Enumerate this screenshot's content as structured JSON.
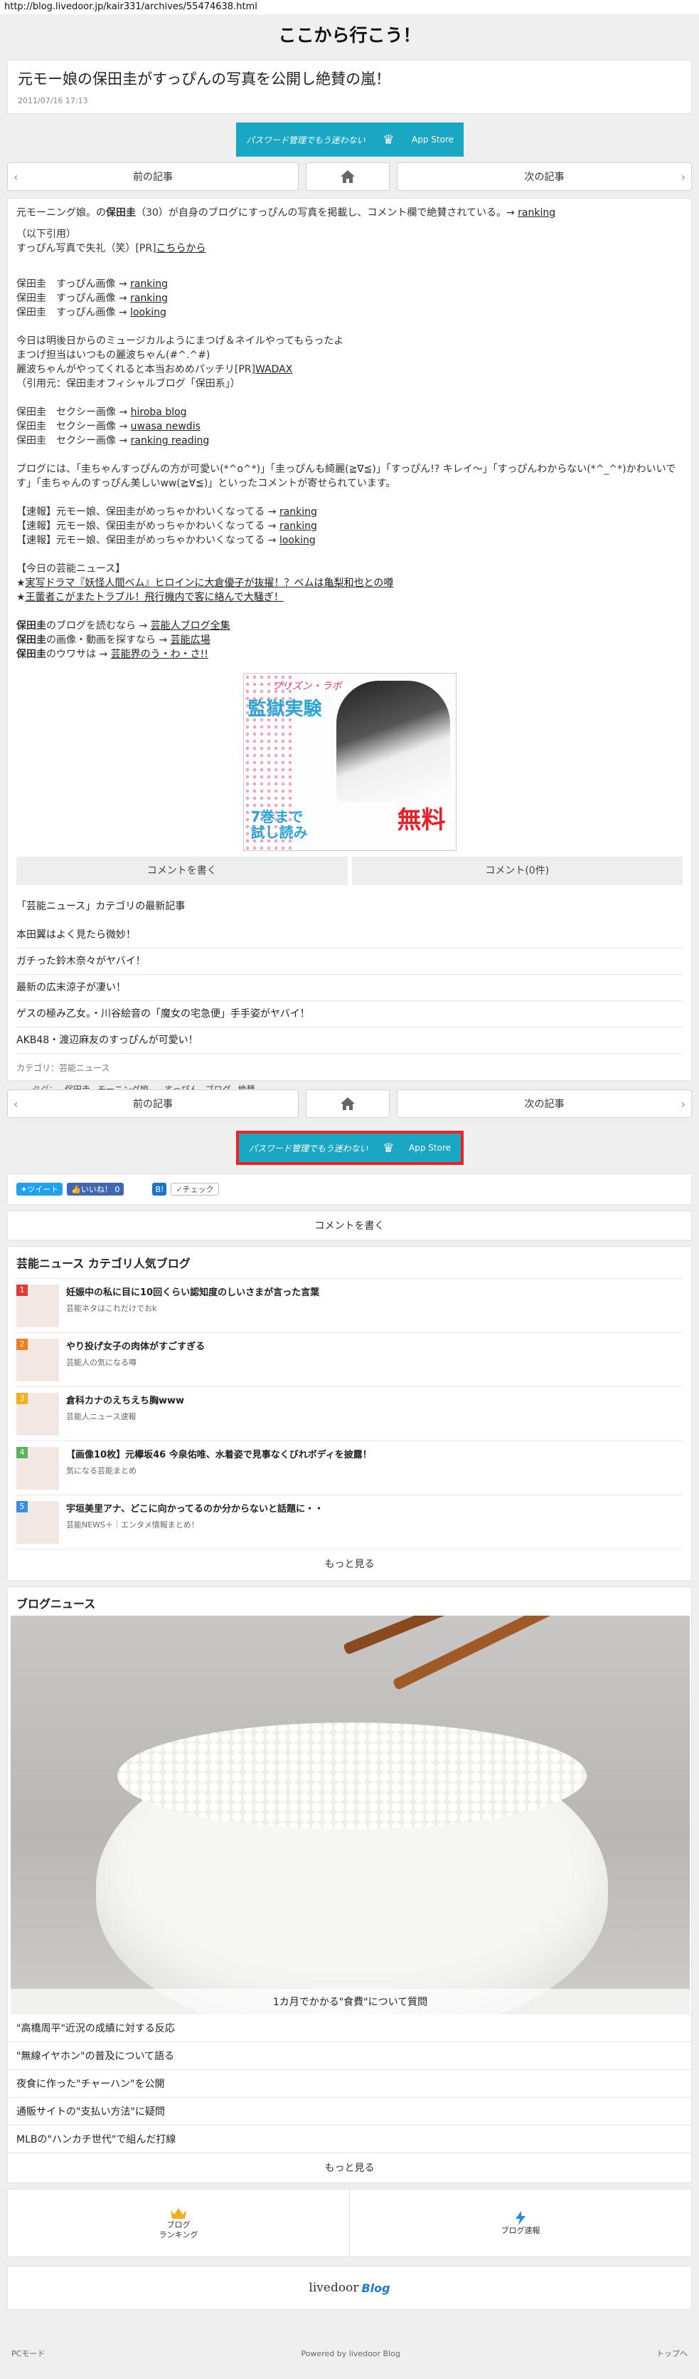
{
  "url": "http://blog.livedoor.jp/kair331/archives/55474638.html",
  "site_title": "ここから行こう！",
  "post": {
    "title": "元モー娘の保田圭がすっぴんの写真を公開し絶賛の嵐！",
    "date": "2011/07/16 17:13"
  },
  "banner": {
    "left": "パスワード管理でもう迷わない",
    "right": "App Store"
  },
  "pager": {
    "prev": "前の記事",
    "next": "次の記事"
  },
  "article": {
    "lead_pre": "元モーニング娘。の",
    "lead_name": "保田圭",
    "lead_post": "（30）が自身のブログにすっぴんの写真を掲載し、コメント欄で絶賛されている。→ ",
    "lead_link": "ranking",
    "quote_head": "（以下引用）",
    "quote_line_pre": "すっぴん写真で失礼（笑）[PR]",
    "quote_line_link": "こちらから",
    "list1": [
      {
        "text": "保田圭　すっぴん画像 → ",
        "link": "ranking"
      },
      {
        "text": "保田圭　すっぴん画像 → ",
        "link": "ranking"
      },
      {
        "text": "保田圭　すっぴん画像 → ",
        "link": "looking"
      }
    ],
    "para2_l1": "今日は明後日からのミュージカルようにまつげ＆ネイルやってもらったよ",
    "para2_l2": "まつげ担当はいつもの麗波ちゃん(#^.^#)",
    "para2_l3_pre": "麗波ちゃんがやってくれると本当おめめパッチリ[PR]",
    "para2_l3_link": "WADAX",
    "para2_l4": "（引用元：保田圭オフィシャルブログ「保田系」）",
    "list2": [
      {
        "text": "保田圭　セクシー画像 → ",
        "link": "hiroba blog"
      },
      {
        "text": "保田圭　セクシー画像 → ",
        "link": "uwasa newdis"
      },
      {
        "text": "保田圭　セクシー画像 → ",
        "link": "ranking reading"
      }
    ],
    "para3_l1": "ブログには、「圭ちゃんすっぴんの方が可愛い(*^o^*)」「圭っぴんも綺麗(≧∇≦)」「すっぴん!? キレイ～」「すっぴんわからない(*^_^*)かわいいで",
    "para3_l2": "す」「圭ちゃんのすっぴん美しいww(≧∀≦)」といったコメントが寄せられています。",
    "list3": [
      {
        "text": "【速報】元モー娘、保田圭がめっちゃかわいくなってる → ",
        "link": "ranking"
      },
      {
        "text": "【速報】元モー娘、保田圭がめっちゃかわいくなってる → ",
        "link": "ranking"
      },
      {
        "text": "【速報】元モー娘、保田圭がめっちゃかわいくなってる → ",
        "link": "looking"
      }
    ],
    "today_head": "【今日の芸能ニュース】",
    "today_items": [
      "実写ドラマ『妖怪人間ベム』ヒロインに大倉優子が抜擢！？ベムは亀梨和也との噂",
      "王蕾者こがまたトラブル！飛行機内で客に絡んで大騒ぎ！"
    ],
    "outro": [
      {
        "bold": "保田圭",
        "text": "のブログを読むなら → ",
        "link": "芸能人ブログ全集"
      },
      {
        "bold": "保田圭",
        "text": "の画像・動画を探すなら → ",
        "link": "芸能広場"
      },
      {
        "bold": "保田圭",
        "text": "のウワサは → ",
        "link": "芸能界のう・わ・さ!!"
      }
    ]
  },
  "ad": {
    "head": "プリズン・ラボ",
    "main": "監獄実験",
    "foot1": "7巻まで\n試し読み",
    "foot2": "無料"
  },
  "buttons": {
    "write_comment": "コメントを書く",
    "comments": "コメント(0件)"
  },
  "related": {
    "title": "「芸能ニュース」カテゴリの最新記事",
    "items": [
      "本田翼はよく見たら微妙！",
      "ガチった鈴木奈々がヤバイ！",
      "最新の広末涼子が凄い！",
      "ゲスの極み乙女。・川谷絵音の「魔女の宅急便」手手姿がヤバイ！",
      "AKB48・渡辺麻友のすっぴんが可愛い！"
    ]
  },
  "meta": {
    "category_label": "カテゴリ：",
    "category": "芸能ニュース",
    "tag_label": "タグ：",
    "tags": [
      "保田圭",
      "モーニング娘。",
      "すっぴん",
      "ブログ",
      "絶賛"
    ]
  },
  "social": {
    "tweet": "ツイート",
    "like": "いいね！ 0",
    "hatena": "B!",
    "check": "チェック"
  },
  "ranking": {
    "title": "芸能ニュース カテゴリ人気ブログ",
    "items": [
      {
        "num": "1",
        "title": "妊娠中の私に目に10回くらい認知度のしいさまが言った言葉",
        "src": "芸能ネタはこれだけでおk",
        "color": "#e53935"
      },
      {
        "num": "2",
        "title": "やり投げ女子の肉体がすごすぎる",
        "src": "芸能人の気になる噂",
        "color": "#ef7c21"
      },
      {
        "num": "3",
        "title": "倉科カナのえちえち胸www",
        "src": "芸能人ニュース速報",
        "color": "#f2b01e"
      },
      {
        "num": "4",
        "title": "【画像10枚】元欅坂46 今泉佑唯、水着姿で見事なくびれボディを披露！",
        "src": "気になる芸能まとめ",
        "color": "#5bb45a"
      },
      {
        "num": "5",
        "title": "宇垣美里アナ、どこに向かってるのか分からないと話題に・・",
        "src": "芸能NEWS＋｜エンタメ情報まとめ！",
        "color": "#3a8de0"
      }
    ],
    "more": "もっと見る"
  },
  "blognews": {
    "title": "ブログニュース",
    "caption": "1カ月でかかる\"食費\"について質問",
    "items": [
      "\"高橋周平\"近況の成績に対する反応",
      "\"無線イヤホン\"の普及について語る",
      "夜食に作った\"チャーハン\"を公開",
      "通販サイトの\"支払い方法\"に疑問",
      "MLBの\"ハンカチ世代\"で組んだ打線"
    ],
    "more": "もっと見る"
  },
  "bottom_nav": {
    "ranking": "ブログ\nランキング",
    "news": "ブログ速報"
  },
  "footer": {
    "logo": "livedoor",
    "logo2": "Blog",
    "pc_mode": "PCモード",
    "powered": "Powered by livedoor Blog",
    "to_top": "トップへ"
  }
}
